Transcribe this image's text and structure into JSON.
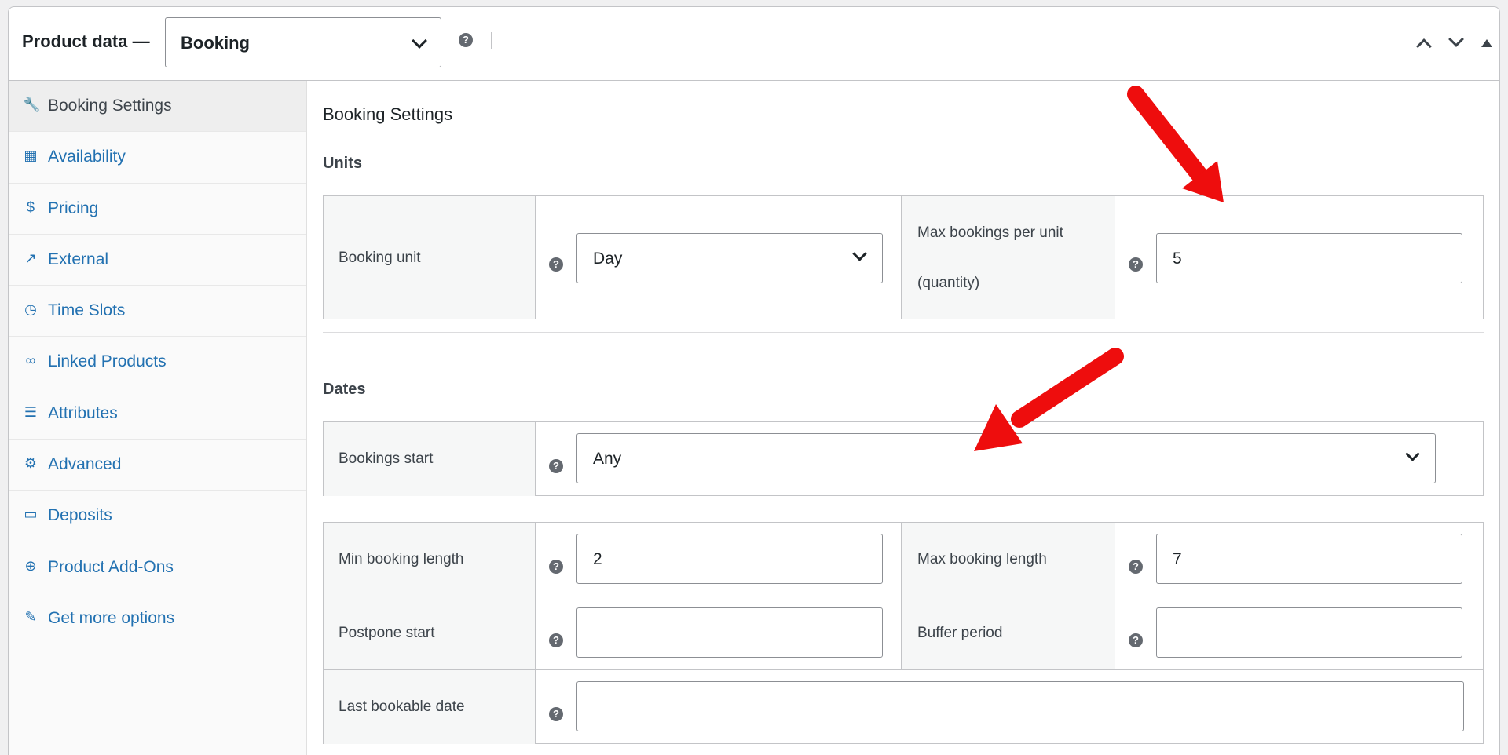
{
  "header": {
    "title": "Product data —",
    "product_type": "Booking",
    "help_icon": "help-icon"
  },
  "sidebar": {
    "items": [
      {
        "label": "Booking Settings",
        "icon": "wrench-icon",
        "glyph": "🔧"
      },
      {
        "label": "Availability",
        "icon": "calendar-icon",
        "glyph": "▦"
      },
      {
        "label": "Pricing",
        "icon": "dollar-circle-icon",
        "glyph": "$"
      },
      {
        "label": "External",
        "icon": "external-link-icon",
        "glyph": "↗"
      },
      {
        "label": "Time Slots",
        "icon": "clock-icon",
        "glyph": "◷"
      },
      {
        "label": "Linked Products",
        "icon": "link-icon",
        "glyph": "∞"
      },
      {
        "label": "Attributes",
        "icon": "list-icon",
        "glyph": "☰"
      },
      {
        "label": "Advanced",
        "icon": "gear-icon",
        "glyph": "⚙"
      },
      {
        "label": "Deposits",
        "icon": "card-icon",
        "glyph": "▭"
      },
      {
        "label": "Product Add-Ons",
        "icon": "plus-circle-icon",
        "glyph": "⊕"
      },
      {
        "label": "Get more options",
        "icon": "plugin-icon",
        "glyph": "✎"
      }
    ]
  },
  "main": {
    "title": "Booking Settings",
    "units": {
      "heading": "Units",
      "booking_unit_label": "Booking unit",
      "booking_unit_value": "Day",
      "max_bookings_label_1": "Max bookings per unit",
      "max_bookings_label_2": "(quantity)",
      "max_bookings_value": "5"
    },
    "dates": {
      "heading": "Dates",
      "bookings_start_label": "Bookings start",
      "bookings_start_value": "Any",
      "min_length_label": "Min booking length",
      "min_length_value": "2",
      "max_length_label": "Max booking length",
      "max_length_value": "7",
      "postpone_label": "Postpone start",
      "postpone_value": "",
      "buffer_label": "Buffer period",
      "buffer_value": "",
      "last_date_label": "Last bookable date",
      "last_date_value": ""
    }
  },
  "colors": {
    "link": "#2271b1",
    "annotation_arrow": "#ee0d0d"
  }
}
